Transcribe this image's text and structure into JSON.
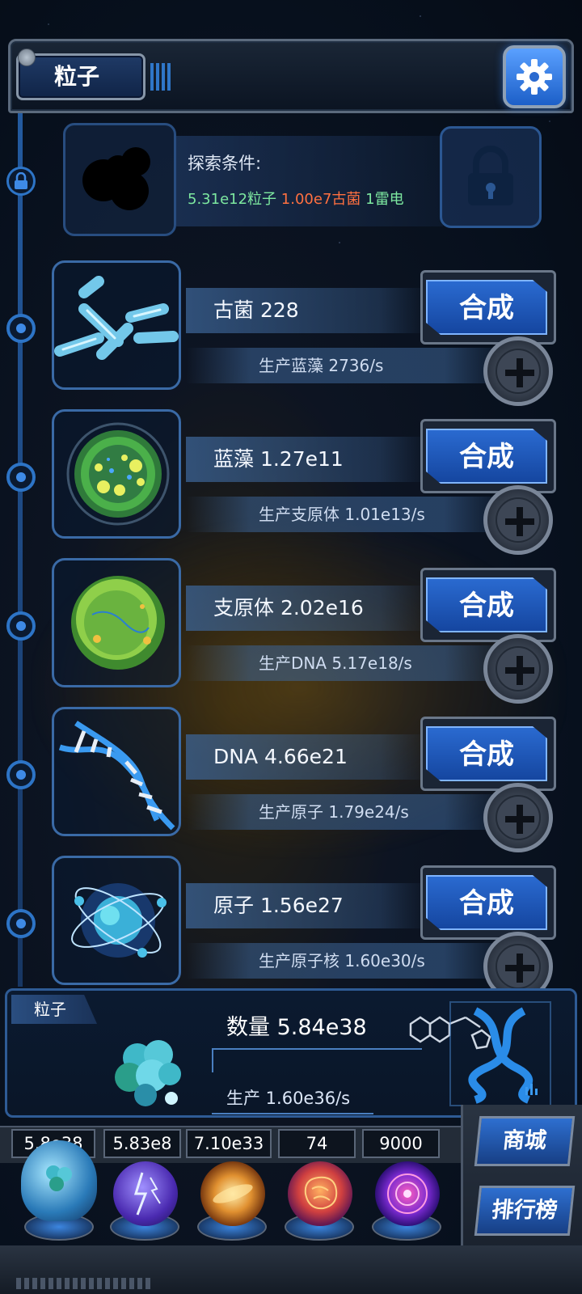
{
  "header": {
    "title": "粒子"
  },
  "locked": {
    "condition_title": "探索条件:",
    "req_particles": "5.31e12粒子",
    "req_archaea": "1.00e7古菌",
    "req_thunder": "1雷电"
  },
  "rows": [
    {
      "name": "古菌 228",
      "production": "生产蓝藻 2736/s",
      "button": "合成",
      "icon": "archaea-icon"
    },
    {
      "name": "蓝藻 1.27e11",
      "production": "生产支原体 1.01e13/s",
      "button": "合成",
      "icon": "cyanobacteria-icon"
    },
    {
      "name": "支原体 2.02e16",
      "production": "生产DNA 5.17e18/s",
      "button": "合成",
      "icon": "mycoplasma-icon"
    },
    {
      "name": "DNA 4.66e21",
      "production": "生产原子 1.79e24/s",
      "button": "合成",
      "icon": "dna-icon"
    },
    {
      "name": "原子 1.56e27",
      "production": "生产原子核 1.60e30/s",
      "button": "合成",
      "icon": "atom-icon"
    }
  ],
  "bottom": {
    "label": "粒子",
    "quantity": "数量 5.84e38",
    "rate": "生产 1.60e36/s"
  },
  "currencies": [
    {
      "value": "5.8e38",
      "orb": "particle-orb"
    },
    {
      "value": "5.83e8",
      "orb": "thunder-orb"
    },
    {
      "value": "7.10e33",
      "orb": "galaxy-orb"
    },
    {
      "value": "74",
      "orb": "brain-orb"
    },
    {
      "value": "9000",
      "orb": "vortex-orb"
    }
  ],
  "side_buttons": {
    "shop": "商城",
    "ranking": "排行榜"
  },
  "colors": {
    "accent_blue": "#1c5fc8",
    "green_text": "#7de8a0",
    "red_text": "#ff7040"
  }
}
